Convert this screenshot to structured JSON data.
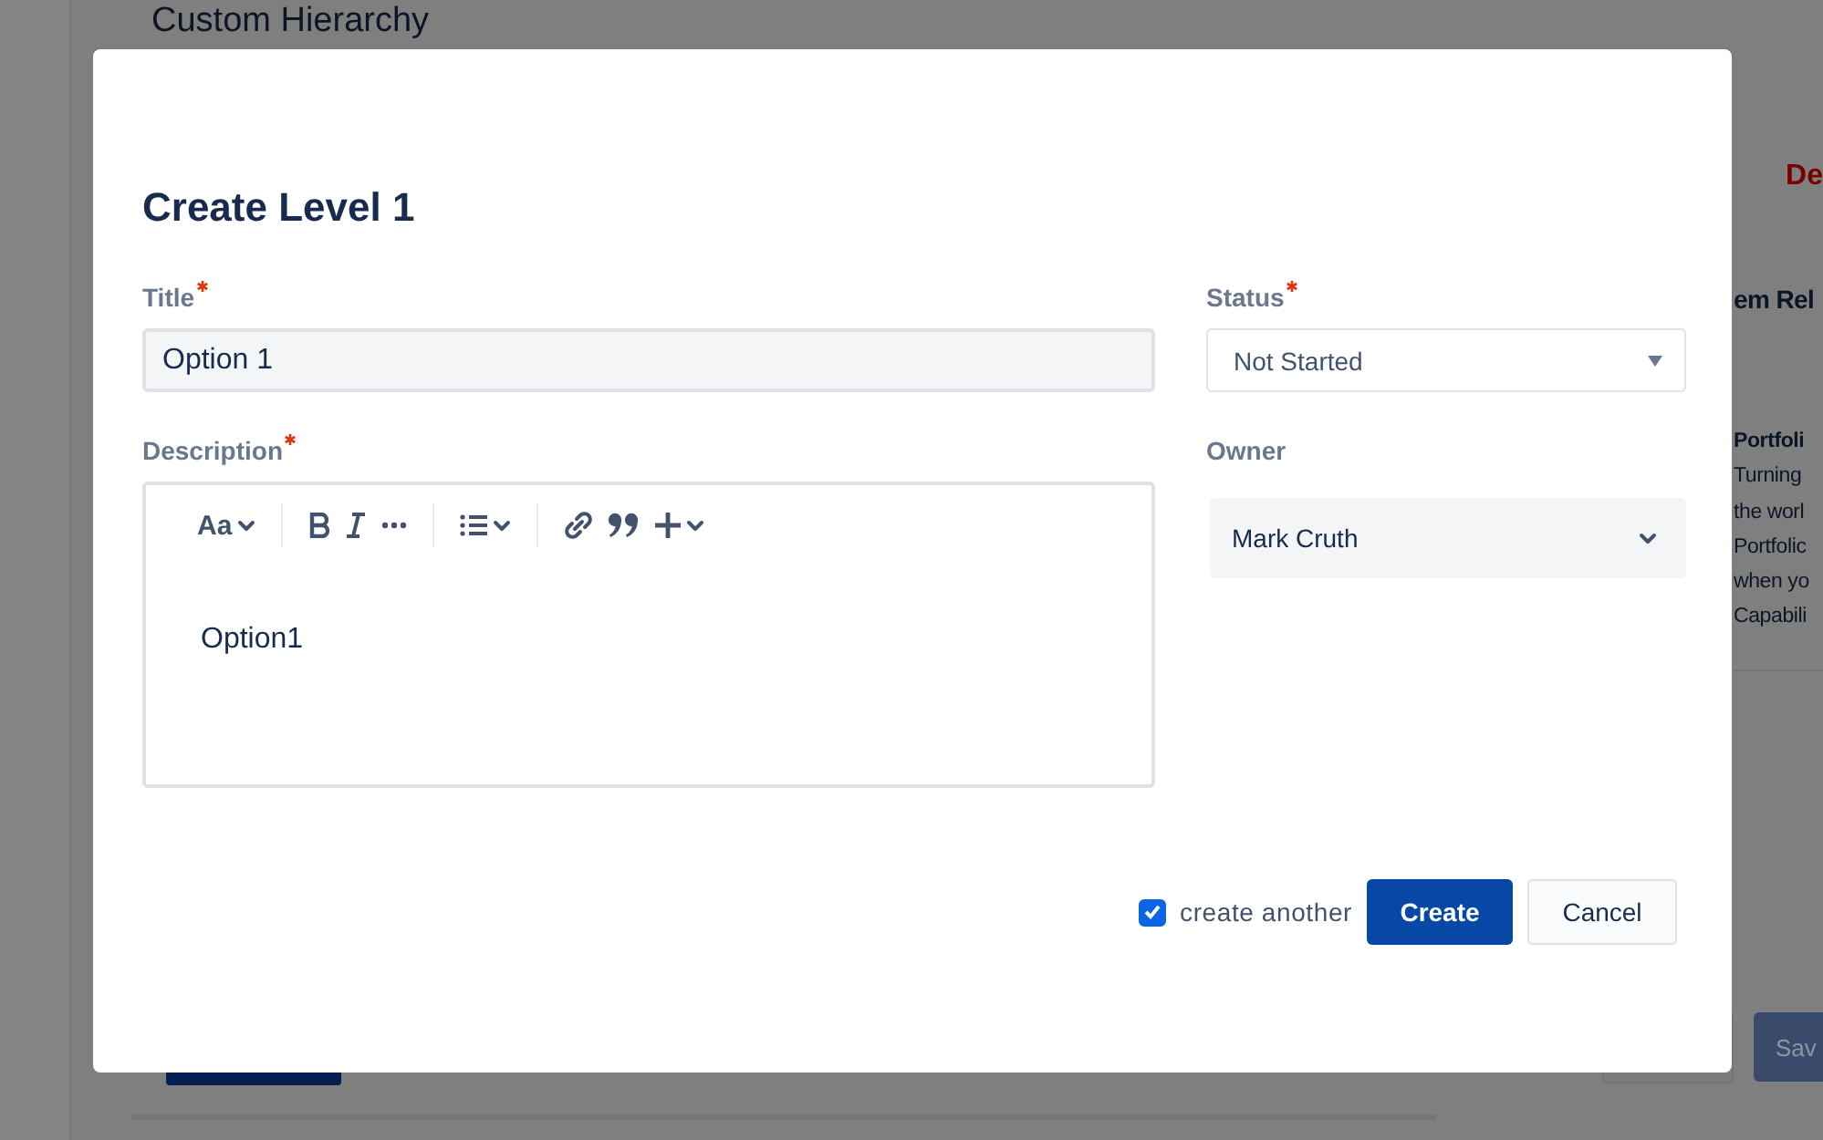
{
  "background": {
    "page_title": "Custom Hierarchy",
    "side_label": "De",
    "section_heading": "em Rel",
    "card_title": "Portfoli",
    "card_lines": [
      "Turning",
      "the worl",
      "Portfolic",
      "when yo",
      "Capabili"
    ],
    "save_button": "Sav"
  },
  "dialog": {
    "title": "Create Level 1",
    "fields": [
      {
        "label": "Title",
        "required": true,
        "kind": "text",
        "value": "Option 1"
      },
      {
        "label": "Status",
        "required": true,
        "kind": "select",
        "value": "Not Started"
      },
      {
        "label": "Description",
        "required": true,
        "kind": "editor",
        "value": "Option1",
        "text_style": "Aa"
      },
      {
        "label": "Owner",
        "required": false,
        "kind": "dropdown",
        "value": "Mark Cruth"
      }
    ],
    "create_another": {
      "label": "create another",
      "checked": true
    },
    "buttons": [
      {
        "label": "Create",
        "kind": "primary"
      },
      {
        "label": "Cancel",
        "kind": "secondary"
      }
    ]
  }
}
